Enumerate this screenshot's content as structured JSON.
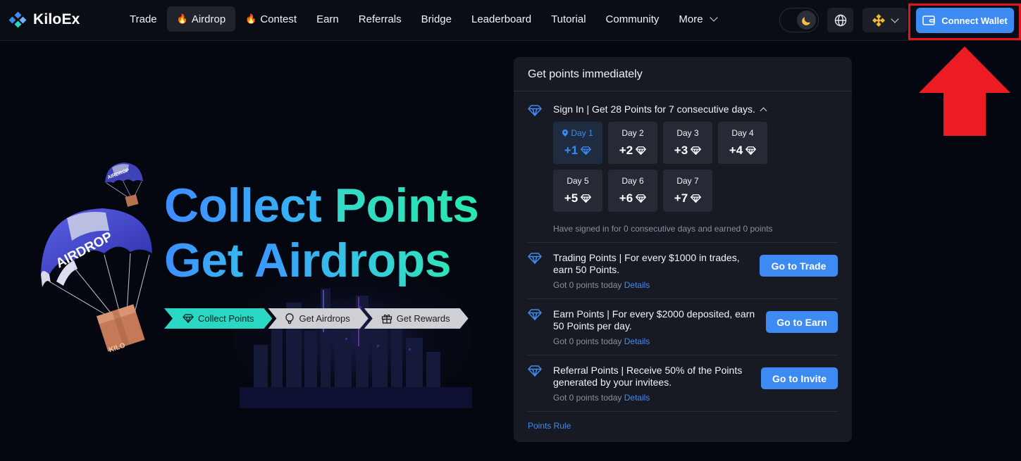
{
  "app": {
    "name": "KiloEx"
  },
  "nav": {
    "items": [
      {
        "label": "Trade",
        "hot": false,
        "active": false
      },
      {
        "label": "Airdrop",
        "hot": true,
        "active": true
      },
      {
        "label": "Contest",
        "hot": true,
        "active": false
      },
      {
        "label": "Earn",
        "hot": false,
        "active": false
      },
      {
        "label": "Referrals",
        "hot": false,
        "active": false
      },
      {
        "label": "Bridge",
        "hot": false,
        "active": false
      },
      {
        "label": "Leaderboard",
        "hot": false,
        "active": false
      },
      {
        "label": "Tutorial",
        "hot": false,
        "active": false
      },
      {
        "label": "Community",
        "hot": false,
        "active": false
      },
      {
        "label": "More",
        "hot": false,
        "active": false
      }
    ],
    "connect_wallet": "Connect Wallet",
    "theme": "dark"
  },
  "hero": {
    "line1_a": "Collect",
    "line1_b": "Points",
    "line2_a": "Get",
    "line2_b": "Airdrops",
    "ribbons": [
      "Collect Points",
      "Get Airdrops",
      "Get Rewards"
    ],
    "parachute_label": "AIRDROP",
    "small_parachute_label": "AIRDROP",
    "box_label": "KILO"
  },
  "panel": {
    "title": "Get points immediately",
    "sign_in": {
      "title": "Sign In | Get 28 Points for 7 consecutive days.",
      "days": [
        {
          "label": "Day 1",
          "points": "+1",
          "today": true
        },
        {
          "label": "Day 2",
          "points": "+2",
          "today": false
        },
        {
          "label": "Day 3",
          "points": "+3",
          "today": false
        },
        {
          "label": "Day 4",
          "points": "+4",
          "today": false
        },
        {
          "label": "Day 5",
          "points": "+5",
          "today": false
        },
        {
          "label": "Day 6",
          "points": "+6",
          "today": false
        },
        {
          "label": "Day 7",
          "points": "+7",
          "today": false
        }
      ],
      "note": "Have signed in for 0 consecutive days and earned 0 points"
    },
    "tasks": [
      {
        "text": "Trading Points | For every $1000 in trades, earn 50 Points.",
        "sub": "Got 0 points today",
        "link": "Details",
        "button": "Go to Trade"
      },
      {
        "text": "Earn Points | For every $2000 deposited, earn 50 Points per day.",
        "sub": "Got 0 points today",
        "link": "Details",
        "button": "Go to Earn"
      },
      {
        "text": "Referral Points | Receive 50% of the Points generated by your invitees.",
        "sub": "Got 0 points today",
        "link": "Details",
        "button": "Go to Invite"
      }
    ],
    "rules_link": "Points Rule"
  },
  "colors": {
    "accent": "#3d8bf2",
    "highlight": "#e3151f",
    "teal": "#2ad6c4"
  }
}
